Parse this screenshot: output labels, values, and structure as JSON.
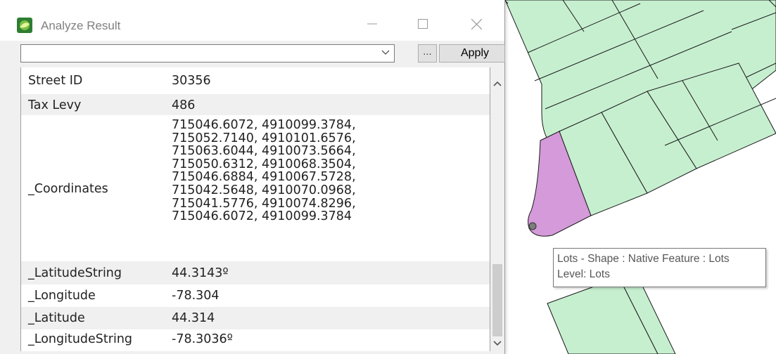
{
  "window": {
    "title": "Analyze Result",
    "apply_label": "Apply",
    "browse_label": "...",
    "selector_value": ""
  },
  "attributes": [
    {
      "name": "Street ID",
      "value": "30356"
    },
    {
      "name": "Tax Levy",
      "value": "486"
    },
    {
      "name": "_Coordinates",
      "lines": [
        "715046.6072, 4910099.3784,",
        "715052.7140, 4910101.6576,",
        "715063.6044, 4910073.5664,",
        "715050.6312, 4910068.3504,",
        "715046.6884, 4910067.5728,",
        "715042.5648, 4910070.0968,",
        "715041.5776, 4910074.8296,",
        "715046.6072, 4910099.3784"
      ]
    },
    {
      "name": "_LatitudeString",
      "value": "44.3143º"
    },
    {
      "name": "_Longitude",
      "value": "-78.304"
    },
    {
      "name": "_Latitude",
      "value": "44.314"
    },
    {
      "name": "_LongitudeString",
      "value": "-78.3036º"
    }
  ],
  "tooltip": {
    "line1": "Lots - Shape : Native Feature : Lots",
    "line2": "Level: Lots"
  },
  "colors": {
    "lot_fill": "#c6efcf",
    "selected_lot_fill": "#d49ad9",
    "lot_outline": "#1a1a1a"
  },
  "icons": [
    "app-icon",
    "minimize-icon",
    "maximize-icon",
    "close-icon",
    "chevron-down-icon",
    "scroll-up-icon",
    "scroll-down-icon"
  ]
}
